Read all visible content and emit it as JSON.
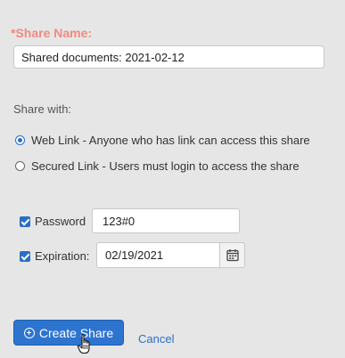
{
  "share_name": {
    "label": "*Share Name:",
    "value": "Shared documents: 2021-02-12"
  },
  "share_with": {
    "label": "Share with:",
    "options": [
      {
        "label": "Web Link - Anyone who has link can access this share",
        "checked": true
      },
      {
        "label": "Secured Link - Users must login to access the share",
        "checked": false
      }
    ]
  },
  "password": {
    "label": "Password",
    "checked": true,
    "value": "123#0"
  },
  "expiration": {
    "label": "Expiration:",
    "checked": true,
    "value": "02/19/2021",
    "icon": "calendar-icon"
  },
  "actions": {
    "create_label": "Create Share",
    "create_icon": "plus-circle-icon",
    "cancel_label": "Cancel"
  },
  "colors": {
    "background": "#e6e6e6",
    "required_label": "#f08a80",
    "accent": "#2a6ec7",
    "primary_button": "#2d74cf"
  }
}
